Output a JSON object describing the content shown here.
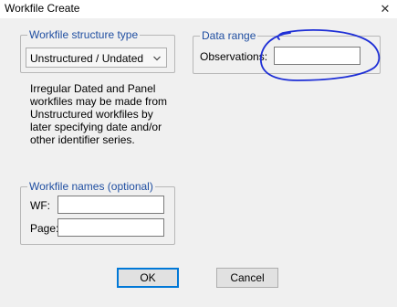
{
  "window": {
    "title": "Workfile Create",
    "close_glyph": "✕"
  },
  "structure_group": {
    "legend": "Workfile structure type",
    "selected_type": "Unstructured / Undated",
    "note": "Irregular Dated and Panel workfiles may be made from Unstructured workfiles by later specifying date and/or other identifier series."
  },
  "data_range_group": {
    "legend": "Data range",
    "observations_label": "Observations:",
    "observations_value": ""
  },
  "names_group": {
    "legend": "Workfile names (optional)",
    "wf_label": "WF:",
    "wf_value": "",
    "page_label": "Page:",
    "page_value": ""
  },
  "buttons": {
    "ok_label": "OK",
    "cancel_label": "Cancel"
  },
  "colors": {
    "legend_text": "#1f4ea1",
    "annotation_ink": "#1e2fd6",
    "default_button_border": "#0078d7"
  },
  "icons": {
    "close": "close-icon",
    "dropdown": "chevron-down-icon"
  }
}
